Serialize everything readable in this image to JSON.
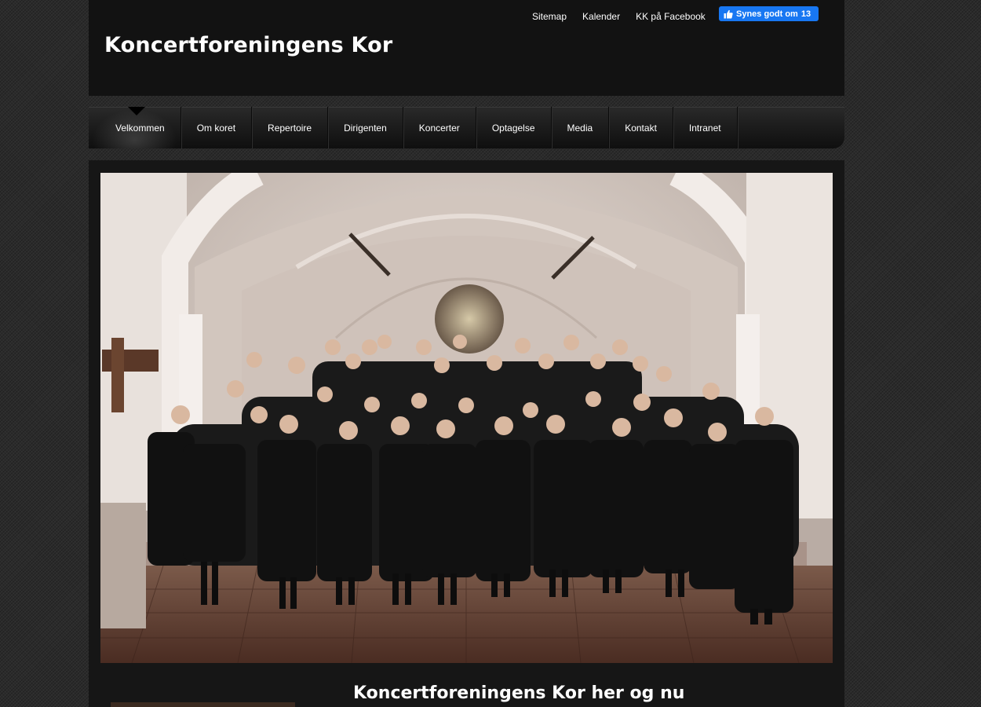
{
  "site": {
    "title": "Koncertforeningens Kor"
  },
  "top_links": [
    {
      "label": "Sitemap"
    },
    {
      "label": "Kalender"
    },
    {
      "label": "KK på Facebook"
    }
  ],
  "facebook_like": {
    "label": "Synes godt om",
    "count": "13",
    "icon": "thumbs-up-icon",
    "color": "#1877f2"
  },
  "nav": {
    "items": [
      {
        "label": "Velkommen",
        "active": true
      },
      {
        "label": "Om koret"
      },
      {
        "label": "Repertoire"
      },
      {
        "label": "Dirigenten"
      },
      {
        "label": "Koncerter"
      },
      {
        "label": "Optagelse"
      },
      {
        "label": "Media"
      },
      {
        "label": "Kontakt"
      },
      {
        "label": "Intranet"
      }
    ]
  },
  "main": {
    "hero_image": "choir-group-photo-in-church",
    "headline": "Koncertforeningens Kor her og nu"
  },
  "colors": {
    "page_background": "#2b2b2b",
    "header_background": "#121212",
    "content_background": "#161616",
    "text": "#ffffff"
  }
}
